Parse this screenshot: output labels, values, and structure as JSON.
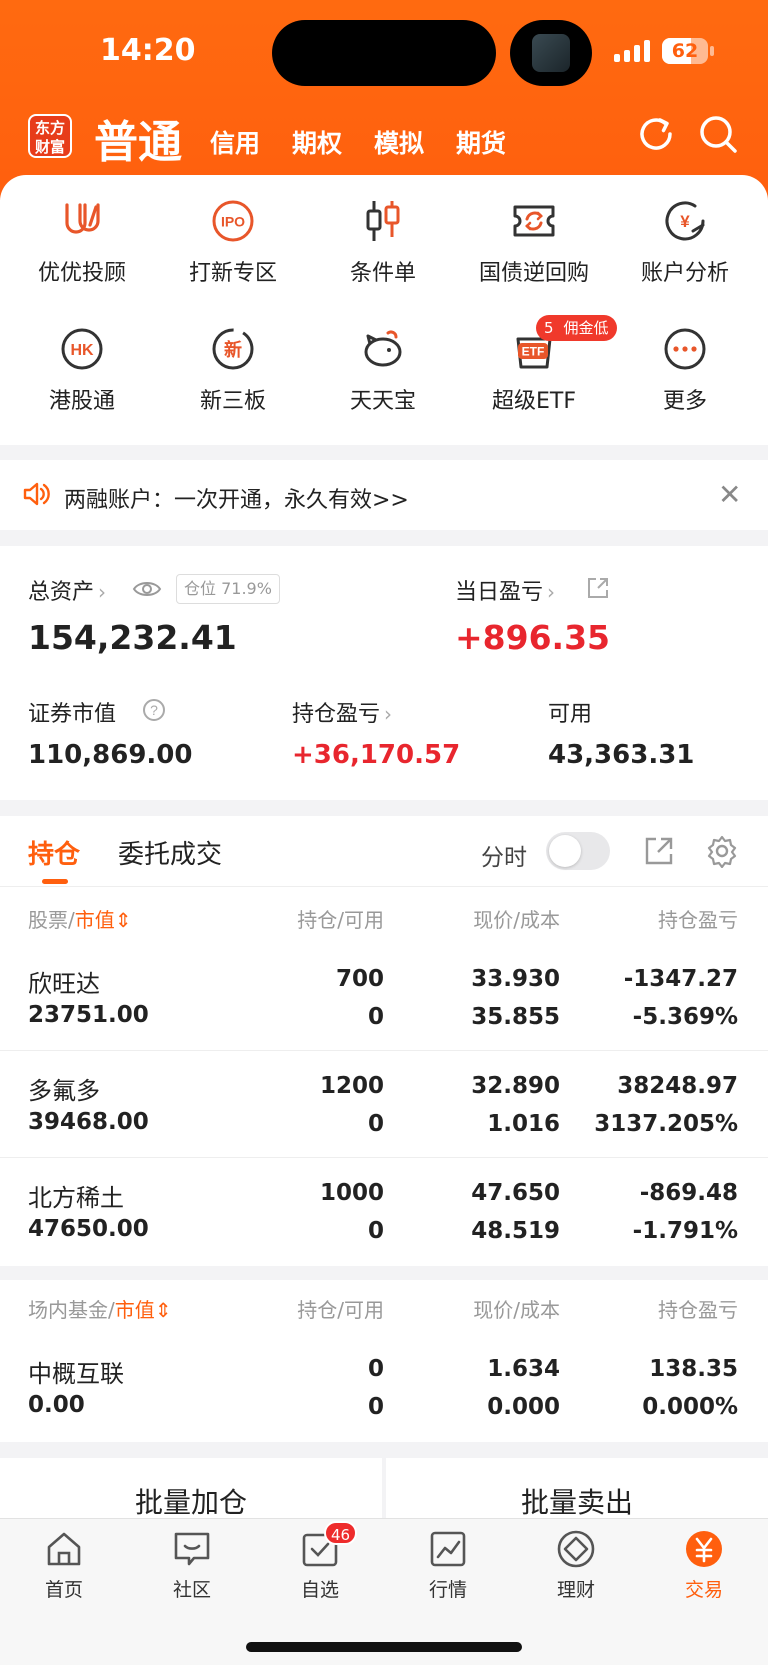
{
  "status": {
    "time": "14:20",
    "battery": "62",
    "battery_level": 0.62
  },
  "header": {
    "logo_text": "东方财富",
    "tabs": [
      {
        "label": "普通"
      },
      {
        "label": "信用"
      },
      {
        "label": "期权"
      },
      {
        "label": "模拟"
      },
      {
        "label": "期货"
      }
    ],
    "icons": [
      "refresh-icon",
      "search-icon"
    ]
  },
  "shortcuts": [
    {
      "label": "优优投顾",
      "icon": "youyou-icon"
    },
    {
      "label": "打新专区",
      "icon": "ipo-icon",
      "icon_text": "IPO"
    },
    {
      "label": "条件单",
      "icon": "candlestick-icon"
    },
    {
      "label": "国债逆回购",
      "icon": "bond-repo-icon"
    },
    {
      "label": "账户分析",
      "icon": "account-analysis-icon",
      "icon_text": "¥"
    },
    {
      "label": "港股通",
      "icon": "hk-icon",
      "icon_text": "HK"
    },
    {
      "label": "新三板",
      "icon": "xin-icon",
      "icon_text": "新"
    },
    {
      "label": "天天宝",
      "icon": "piggy-icon"
    },
    {
      "label": "超级ETF",
      "icon": "etf-icon",
      "icon_text": "ETF"
    },
    {
      "label": "更多",
      "icon": "more-icon"
    }
  ],
  "promo_badge": {
    "count": "5",
    "text": "佣金低"
  },
  "notice": {
    "text": "两融账户：一次开通，永久有效>>"
  },
  "assets": {
    "total_label": "总资产",
    "position_tag": "仓位 71.9%",
    "total_value": "154,232.41",
    "daily_pnl_label": "当日盈亏",
    "daily_pnl_value": "+896.35",
    "market_value_label": "证券市值",
    "market_value": "110,869.00",
    "hold_pnl_label": "持仓盈亏",
    "hold_pnl_value": "+36,170.57",
    "available_label": "可用",
    "available_value": "43,363.31"
  },
  "holdings": {
    "tab_positions": "持仓",
    "tab_orders": "委托成交",
    "fenshi_label": "分时",
    "stock_header": {
      "c1": "股票",
      "sort": "市值",
      "c2": "持仓/可用",
      "c3": "现价/成本",
      "c4": "持仓盈亏"
    },
    "stocks": [
      {
        "name": "欣旺达",
        "mv": "23751.00",
        "qty": "700",
        "avail": "0",
        "price": "33.930",
        "cost": "35.855",
        "pnl": "-1347.27",
        "pct": "-5.369%",
        "dir": "down"
      },
      {
        "name": "多氟多",
        "mv": "39468.00",
        "qty": "1200",
        "avail": "0",
        "price": "32.890",
        "cost": "1.016",
        "pnl": "38248.97",
        "pct": "3137.205%",
        "dir": "up"
      },
      {
        "name": "北方稀土",
        "mv": "47650.00",
        "qty": "1000",
        "avail": "0",
        "price": "47.650",
        "cost": "48.519",
        "pnl": "-869.48",
        "pct": "-1.791%",
        "dir": "down"
      }
    ],
    "fund_header": {
      "c1": "场内基金",
      "sort": "市值",
      "c2": "持仓/可用",
      "c3": "现价/成本",
      "c4": "持仓盈亏"
    },
    "funds": [
      {
        "name": "中概互联",
        "mv": "0.00",
        "qty": "0",
        "avail": "0",
        "price": "1.634",
        "cost": "0.000",
        "pnl": "138.35",
        "pct": "0.000%",
        "dir": "up"
      }
    ]
  },
  "batch": {
    "add": "批量加仓",
    "sell": "批量卖出"
  },
  "tabbar": [
    {
      "label": "首页",
      "icon": "home-icon"
    },
    {
      "label": "社区",
      "icon": "community-icon"
    },
    {
      "label": "自选",
      "icon": "watchlist-icon",
      "badge": "46"
    },
    {
      "label": "行情",
      "icon": "market-icon"
    },
    {
      "label": "理财",
      "icon": "wealth-icon"
    },
    {
      "label": "交易",
      "icon": "trade-icon",
      "active": true
    }
  ],
  "colors": {
    "brand": "#ff5f0e",
    "up": "#e8262e",
    "down": "#17a336"
  }
}
